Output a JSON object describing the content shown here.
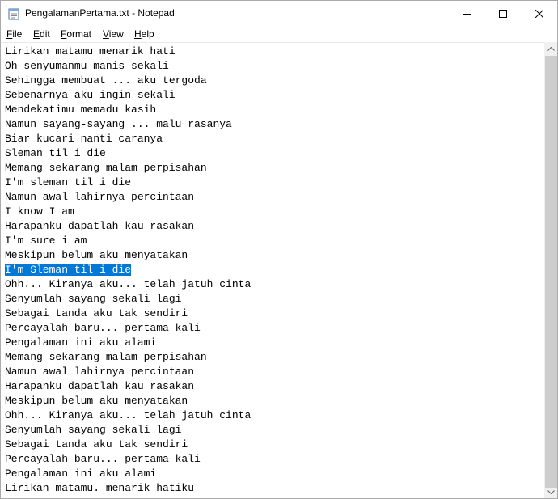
{
  "window": {
    "title": "PengalamanPertama.txt - Notepad"
  },
  "menu": [
    "File",
    "Edit",
    "Format",
    "View",
    "Help"
  ],
  "editor": {
    "selected_index": 15,
    "lines": [
      "Lirikan matamu menarik hati",
      "Oh senyumanmu manis sekali",
      "Sehingga membuat ... aku tergoda",
      "Sebenarnya aku ingin sekali",
      "Mendekatimu memadu kasih",
      "Namun sayang-sayang ... malu rasanya",
      "Biar kucari nanti caranya",
      "Sleman til i die",
      "Memang sekarang malam perpisahan",
      "I'm sleman til i die",
      "Namun awal lahirnya percintaan",
      "I know I am",
      "Harapanku dapatlah kau rasakan",
      "I'm sure i am",
      "Meskipun belum aku menyatakan",
      "I'm Sleman til i die",
      "Ohh... Kiranya aku... telah jatuh cinta",
      "Senyumlah sayang sekali lagi",
      "Sebagai tanda aku tak sendiri",
      "Percayalah baru... pertama kali",
      "Pengalaman ini aku alami",
      "Memang sekarang malam perpisahan",
      "Namun awal lahirnya percintaan",
      "Harapanku dapatlah kau rasakan",
      "Meskipun belum aku menyatakan",
      "Ohh... Kiranya aku... telah jatuh cinta",
      "Senyumlah sayang sekali lagi",
      "Sebagai tanda aku tak sendiri",
      "Percayalah baru... pertama kali",
      "Pengalaman ini aku alami",
      "Lirikan matamu. menarik hatiku"
    ]
  },
  "colors": {
    "selection": "#0078d7",
    "scroll_track": "#f0f0f0",
    "scroll_thumb": "#cdcdcd"
  },
  "icons": {
    "app": "notepad-icon",
    "minimize": "minimize-icon",
    "maximize": "maximize-icon",
    "close": "close-icon",
    "scroll_up": "chevron-up-icon",
    "scroll_down": "chevron-down-icon"
  }
}
